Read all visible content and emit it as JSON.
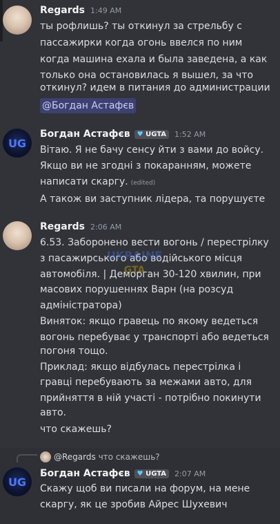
{
  "messages": [
    {
      "author": "Regards",
      "time": "1:49 AM",
      "lines": [
        "ты рофлишь? ты откинул за стрельбу с",
        "пассажирки когда огонь ввелся по ним",
        "когда машина ехала и была заведена, а как",
        "только она остановилась я вышел, за что",
        "откинул? идем в питания до администрации"
      ],
      "mention": "@Богдан Астафєв"
    },
    {
      "author": "Богдан Астафєв",
      "tag": "UGTA",
      "time": "1:52 AM",
      "lines": [
        "Вітаю. Я не бачу сенсу йти з вами до войсу.",
        "Якщо ви не згодні з покаранням, можете",
        "написати скаргу."
      ],
      "edited": "(edited)",
      "extra": "А також ви заступник лідера, та порушуєте"
    },
    {
      "author": "Regards",
      "time": "2:06 AM",
      "lines": [
        "6.53. Заборонено вести вогонь / перестрілку",
        "з пасажирського або водійського місця",
        "автомобіля. | Деморган 30-120 хвилин, при",
        "масових порушеннях Варн (на розсуд",
        "адміністратора)",
        "Виняток: якщо гравець по якому ведеться",
        "вогонь перебуває у транспорті або ведеться",
        "погоня тощо.",
        "Приклад: якщо відбулась перестрілка і",
        "гравці перебувають за межами авто, для",
        "прийняття в ній участі - потрібно покинути",
        "авто."
      ],
      "extra": "что скажешь?"
    },
    {
      "reply_to_name": "@Regards",
      "reply_to_text": "что скажешь?",
      "author": "Богдан Астафєв",
      "tag": "UGTA",
      "time": "2:07 AM",
      "lines": [
        "Скажу щоб ви писали на форум, на мене",
        "скаргу, як це зробив Айрес Шухевич"
      ]
    }
  ]
}
